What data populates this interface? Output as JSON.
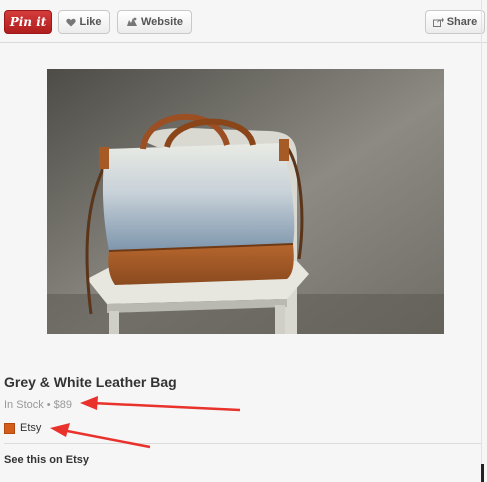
{
  "toolbar": {
    "pin_label": "Pin it",
    "like_label": "Like",
    "website_label": "Website",
    "share_label": "Share",
    "icons": {
      "like": "heart-icon",
      "website": "website-icon",
      "share": "share-icon"
    }
  },
  "pin": {
    "image_alt": "grey-white-leather-bag-photo",
    "title": "Grey & White Leather Bag",
    "availability": "In Stock",
    "separator": "•",
    "price": "$89",
    "source_name": "Etsy",
    "see_link": "See this on Etsy"
  },
  "colors": {
    "pin_button": "#c82828",
    "annotation_arrow": "#e8322b",
    "favicon": "#d35e1c"
  }
}
